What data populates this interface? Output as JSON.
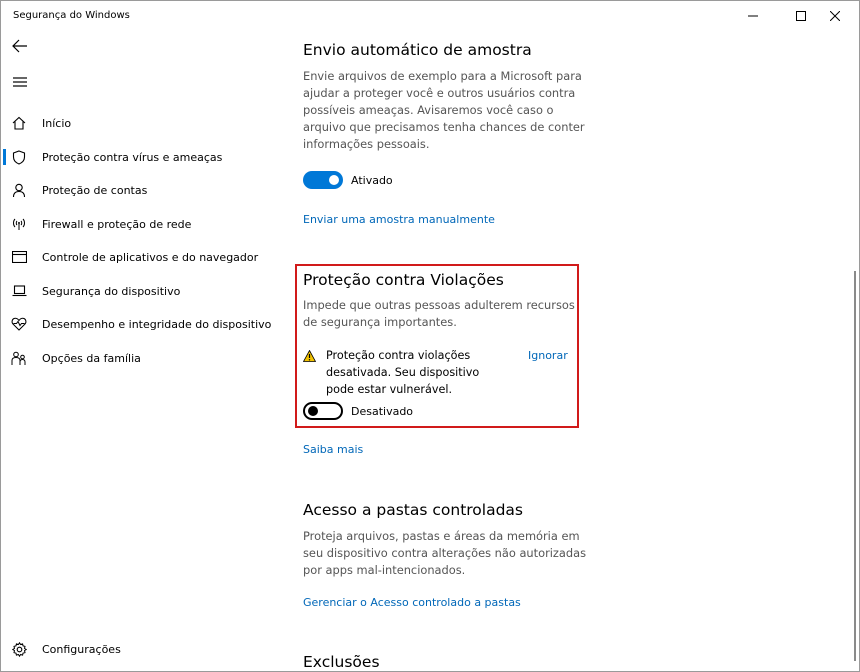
{
  "window": {
    "title": "Segurança do Windows"
  },
  "sidebar": {
    "items": [
      {
        "label": "Início",
        "icon": "home-icon"
      },
      {
        "label": "Proteção contra vírus e ameaças",
        "icon": "shield-icon",
        "active": true
      },
      {
        "label": "Proteção de contas",
        "icon": "person-icon"
      },
      {
        "label": "Firewall e proteção de rede",
        "icon": "wifi-antenna-icon"
      },
      {
        "label": "Controle de aplicativos e do navegador",
        "icon": "browser-window-icon"
      },
      {
        "label": "Segurança do dispositivo",
        "icon": "laptop-icon"
      },
      {
        "label": "Desempenho e integridade do dispositivo",
        "icon": "heart-pulse-icon"
      },
      {
        "label": "Opções da família",
        "icon": "family-icon"
      }
    ],
    "settings_label": "Configurações"
  },
  "sections": {
    "sample": {
      "title": "Envio automático de amostra",
      "description": "Envie arquivos de exemplo para a Microsoft para ajudar a proteger você e outros usuários contra possíveis ameaças. Avisaremos você caso o arquivo que precisamos tenha chances de conter informações pessoais.",
      "toggle_label": "Ativado",
      "toggle_on": true,
      "link": "Enviar uma amostra manualmente"
    },
    "tamper": {
      "title": "Proteção contra Violações",
      "description": "Impede que outras pessoas adulterem recursos de segurança importantes.",
      "warning": "Proteção contra violações desativada. Seu dispositivo pode estar vulnerável.",
      "dismiss": "Ignorar",
      "toggle_label": "Desativado",
      "toggle_on": false,
      "link": "Saiba mais"
    },
    "folders": {
      "title": "Acesso a pastas controladas",
      "description": "Proteja arquivos, pastas e áreas da memória em seu dispositivo contra alterações não autorizadas por apps mal-intencionados.",
      "link": "Gerenciar o Acesso controlado a pastas"
    },
    "exclusions": {
      "title": "Exclusões"
    }
  },
  "colors": {
    "accent": "#0078d7",
    "link": "#0067b8",
    "highlight_border": "#d11a1a",
    "warning": "#f2c200"
  }
}
